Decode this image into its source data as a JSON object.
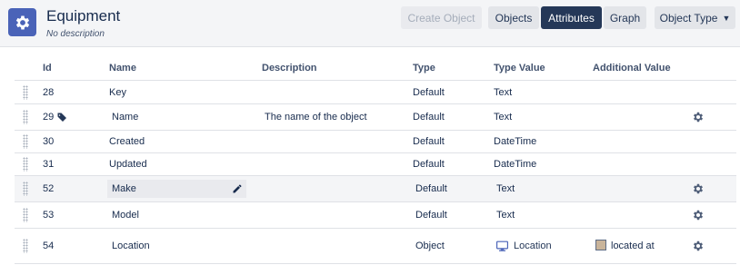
{
  "header": {
    "title": "Equipment",
    "subtitle": "No description",
    "buttons": {
      "create_object": "Create Object",
      "objects": "Objects",
      "attributes": "Attributes",
      "graph": "Graph",
      "object_type": "Object Type"
    }
  },
  "table": {
    "columns": [
      "Id",
      "Name",
      "Description",
      "Type",
      "Type Value",
      "Additional Value"
    ],
    "rows": [
      {
        "id": "28",
        "name": "Key",
        "description": "",
        "type": "Default",
        "type_value": "Text",
        "additional_value": ""
      },
      {
        "id": "29",
        "name": "Name",
        "description": "The name of the object",
        "type": "Default",
        "type_value": "Text",
        "additional_value": ""
      },
      {
        "id": "30",
        "name": "Created",
        "description": "",
        "type": "Default",
        "type_value": "DateTime",
        "additional_value": ""
      },
      {
        "id": "31",
        "name": "Updated",
        "description": "",
        "type": "Default",
        "type_value": "DateTime",
        "additional_value": ""
      },
      {
        "id": "52",
        "name": "Make",
        "description": "",
        "type": "Default",
        "type_value": "Text",
        "additional_value": ""
      },
      {
        "id": "53",
        "name": "Model",
        "description": "",
        "type": "Default",
        "type_value": "Text",
        "additional_value": ""
      },
      {
        "id": "54",
        "name": "Location",
        "description": "",
        "type": "Object",
        "type_value": "Location",
        "additional_value": "located at"
      }
    ]
  },
  "colors": {
    "accent": "#4a63b8",
    "active_button": "#253858",
    "swatch": "#c9b49a"
  },
  "icons": {
    "app": "gear-icon",
    "label": "tag-icon",
    "edit": "pencil-icon",
    "settings": "gear-icon",
    "object_reference": "monitor-icon"
  }
}
